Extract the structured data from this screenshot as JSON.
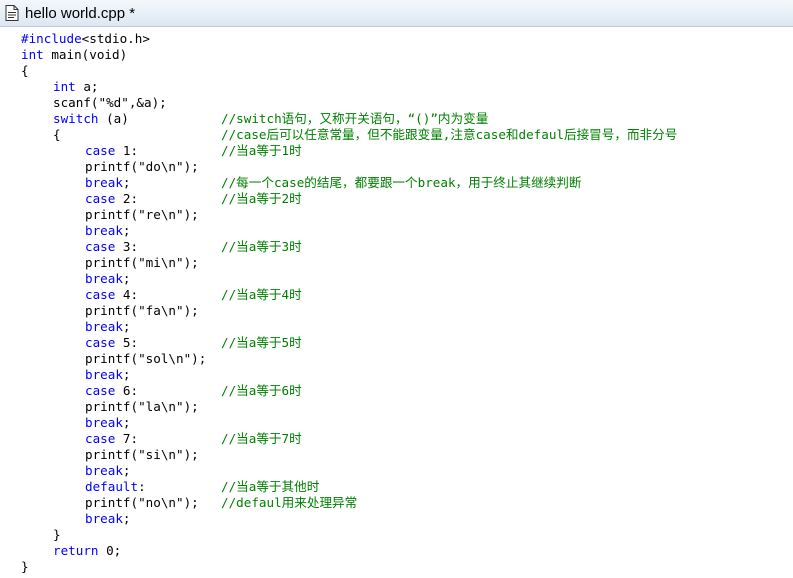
{
  "window": {
    "title": "hello world.cpp *",
    "icon": "document-icon"
  },
  "colors": {
    "keyword": "#0000ff",
    "comment": "#008000",
    "text": "#000000",
    "background": "#ffffff"
  },
  "editor": {
    "lines": [
      {
        "indent": 0,
        "keyword": "#include",
        "code": "<stdio.h>",
        "comment": ""
      },
      {
        "indent": 0,
        "keyword": "int",
        "code": " main(void)",
        "comment": ""
      },
      {
        "indent": 0,
        "keyword": "",
        "code": "{",
        "comment": ""
      },
      {
        "indent": 1,
        "keyword": "int",
        "code": " a;",
        "comment": ""
      },
      {
        "indent": 1,
        "keyword": "",
        "code": "scanf(\"%d\",&a);",
        "comment": ""
      },
      {
        "indent": 1,
        "keyword": "switch",
        "code": " (a)",
        "comment": "//switch语句，又称开关语句，“()”内为变量"
      },
      {
        "indent": 1,
        "keyword": "",
        "code": "{",
        "comment": "//case后可以任意常量，但不能跟变量,注意case和defaul后接冒号，而非分号"
      },
      {
        "indent": 2,
        "keyword": "case",
        "code": " 1:",
        "comment": "//当a等于1时"
      },
      {
        "indent": 2,
        "keyword": "",
        "code": "printf(\"do\\n\");",
        "comment": ""
      },
      {
        "indent": 2,
        "keyword": "break",
        "code": ";",
        "comment": "//每一个case的结尾，都要跟一个break，用于终止其继续判断"
      },
      {
        "indent": 2,
        "keyword": "case",
        "code": " 2:",
        "comment": "//当a等于2时"
      },
      {
        "indent": 2,
        "keyword": "",
        "code": "printf(\"re\\n\");",
        "comment": ""
      },
      {
        "indent": 2,
        "keyword": "break",
        "code": ";",
        "comment": ""
      },
      {
        "indent": 2,
        "keyword": "case",
        "code": " 3:",
        "comment": "//当a等于3时"
      },
      {
        "indent": 2,
        "keyword": "",
        "code": "printf(\"mi\\n\");",
        "comment": ""
      },
      {
        "indent": 2,
        "keyword": "break",
        "code": ";",
        "comment": ""
      },
      {
        "indent": 2,
        "keyword": "case",
        "code": " 4:",
        "comment": "//当a等于4时"
      },
      {
        "indent": 2,
        "keyword": "",
        "code": "printf(\"fa\\n\");",
        "comment": ""
      },
      {
        "indent": 2,
        "keyword": "break",
        "code": ";",
        "comment": ""
      },
      {
        "indent": 2,
        "keyword": "case",
        "code": " 5:",
        "comment": "//当a等于5时"
      },
      {
        "indent": 2,
        "keyword": "",
        "code": "printf(\"sol\\n\");",
        "comment": ""
      },
      {
        "indent": 2,
        "keyword": "break",
        "code": ";",
        "comment": ""
      },
      {
        "indent": 2,
        "keyword": "case",
        "code": " 6:",
        "comment": "//当a等于6时"
      },
      {
        "indent": 2,
        "keyword": "",
        "code": "printf(\"la\\n\");",
        "comment": ""
      },
      {
        "indent": 2,
        "keyword": "break",
        "code": ";",
        "comment": ""
      },
      {
        "indent": 2,
        "keyword": "case",
        "code": " 7:",
        "comment": "//当a等于7时"
      },
      {
        "indent": 2,
        "keyword": "",
        "code": "printf(\"si\\n\");",
        "comment": ""
      },
      {
        "indent": 2,
        "keyword": "break",
        "code": ";",
        "comment": ""
      },
      {
        "indent": 2,
        "keyword": "default",
        "code": ":",
        "comment": "//当a等于其他时"
      },
      {
        "indent": 2,
        "keyword": "",
        "code": "printf(\"no\\n\");",
        "comment": "//defaul用来处理异常"
      },
      {
        "indent": 2,
        "keyword": "break",
        "code": ";",
        "comment": ""
      },
      {
        "indent": 1,
        "keyword": "",
        "code": "}",
        "comment": ""
      },
      {
        "indent": 1,
        "keyword": "return",
        "code": " 0;",
        "comment": ""
      },
      {
        "indent": 0,
        "keyword": "",
        "code": "}",
        "comment": ""
      }
    ]
  }
}
